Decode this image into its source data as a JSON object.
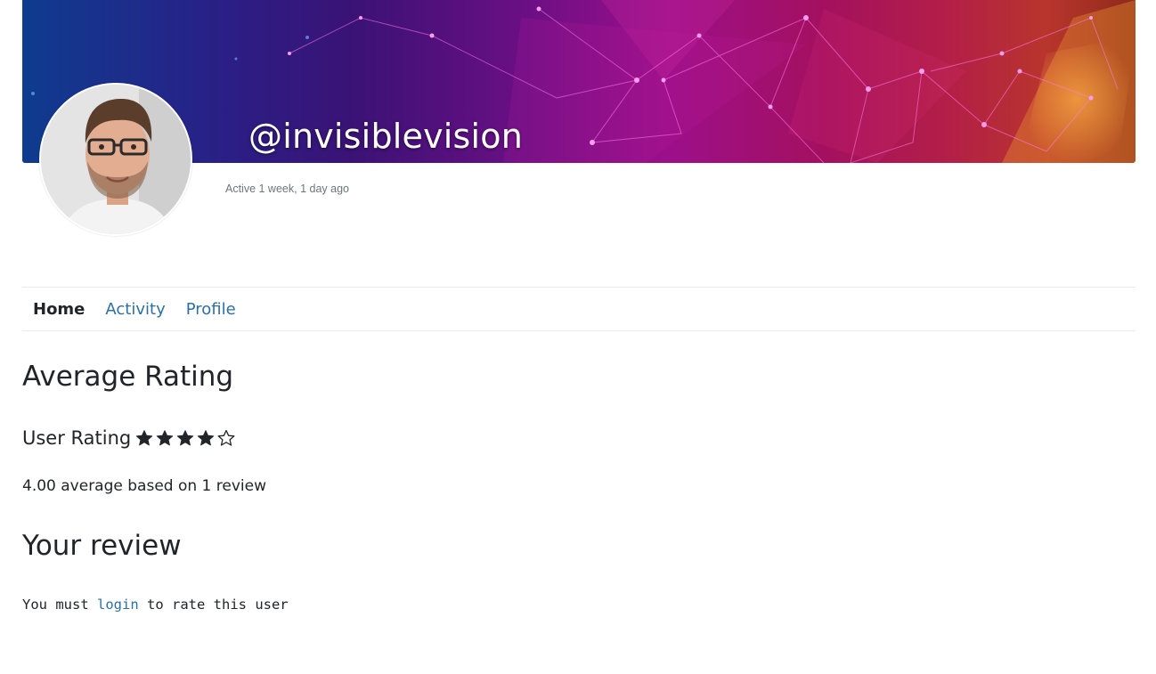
{
  "profile": {
    "username": "@invisiblevision",
    "last_active": "Active 1 week, 1 day ago"
  },
  "nav": {
    "items": [
      {
        "label": "Home",
        "active": true
      },
      {
        "label": "Activity",
        "active": false
      },
      {
        "label": "Profile",
        "active": false
      }
    ]
  },
  "rating": {
    "heading": "Average Rating",
    "label": "User Rating",
    "stars_filled": 4,
    "stars_total": 5,
    "summary": "4.00 average based on 1 review"
  },
  "review": {
    "heading": "Your review",
    "prefix": "You must ",
    "link_label": "login",
    "suffix": " to rate this user"
  },
  "colors": {
    "link": "#2e6fa5",
    "text": "#212529",
    "muted": "#6c757d"
  },
  "icons": {
    "star_filled": "star-filled-icon",
    "star_empty": "star-empty-icon"
  }
}
